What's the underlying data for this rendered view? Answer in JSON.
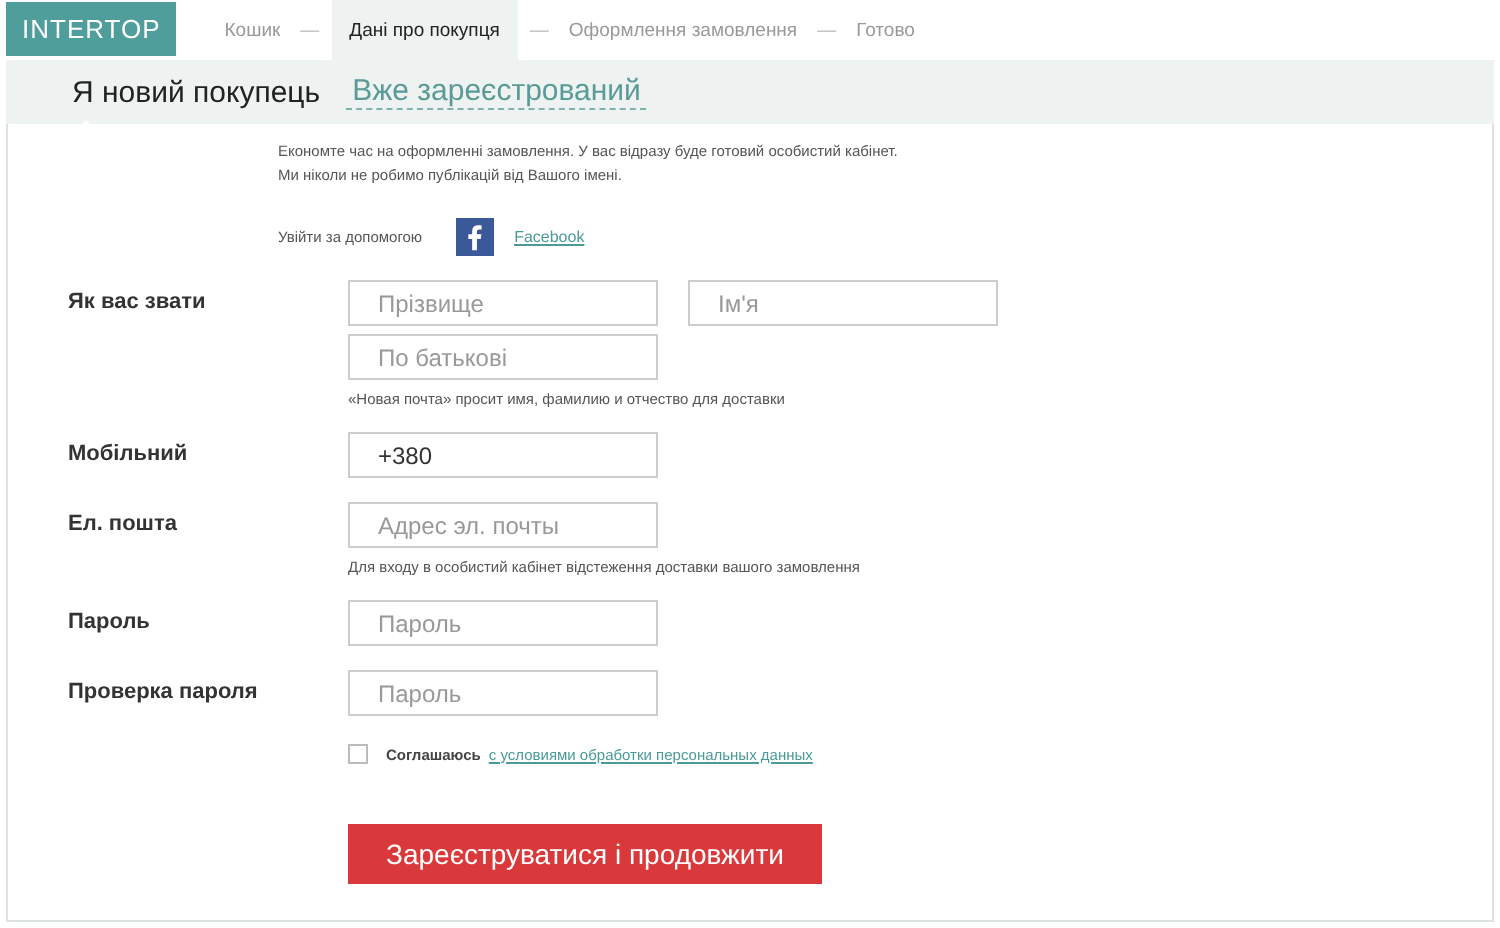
{
  "logo": "INTERTOP",
  "steps": [
    {
      "kind": "step",
      "label": "Кошик",
      "selected": false
    },
    {
      "kind": "separator",
      "label": "—"
    },
    {
      "kind": "step",
      "label": "Дані про покупця",
      "selected": true
    },
    {
      "kind": "separator",
      "label": "—"
    },
    {
      "kind": "step",
      "label": "Оформлення замовлення",
      "selected": false
    },
    {
      "kind": "separator",
      "label": "—"
    },
    {
      "kind": "step",
      "label": "Готово",
      "selected": false
    }
  ],
  "tabs": [
    {
      "label": "Я новий покупець",
      "selected": true
    },
    {
      "label": "Вже зареєстрований",
      "selected": false
    }
  ],
  "intro": [
    "Економте час на оформленні замовлення. У вас відразу буде готовий особистий кабінет.",
    "Ми ніколи не робимо публікацій від Вашого імені."
  ],
  "social": {
    "label": "Увійти за допомогою",
    "link": "Facebook"
  },
  "fields": [
    {
      "label": "Як вас звати",
      "lines": [
        [
          {
            "placeholder": "Прізвище"
          },
          {
            "placeholder": "Ім'я"
          }
        ],
        [
          {
            "placeholder": "По батькові"
          }
        ]
      ],
      "hint": "«Новая почта» просит имя, фамилию и отчество для доставки"
    },
    {
      "label": "Мобільний",
      "lines": [
        [
          {
            "value": "+380"
          }
        ]
      ]
    },
    {
      "label": "Ел. пошта",
      "lines": [
        [
          {
            "placeholder": "Адрес эл. почты"
          }
        ]
      ],
      "hint": "Для входу в особистий кабінет відстеження доставки вашого замовлення"
    },
    {
      "label": "Пароль",
      "lines": [
        [
          {
            "placeholder": "Пароль"
          }
        ]
      ]
    },
    {
      "label": "Проверка пароля",
      "lines": [
        [
          {
            "placeholder": "Пароль"
          }
        ]
      ]
    }
  ],
  "agreement": {
    "checked": false,
    "text": "Соглашаюсь",
    "link": "с условиями обработки персональных данных"
  },
  "submit": "Зареєструватися і продовжити"
}
